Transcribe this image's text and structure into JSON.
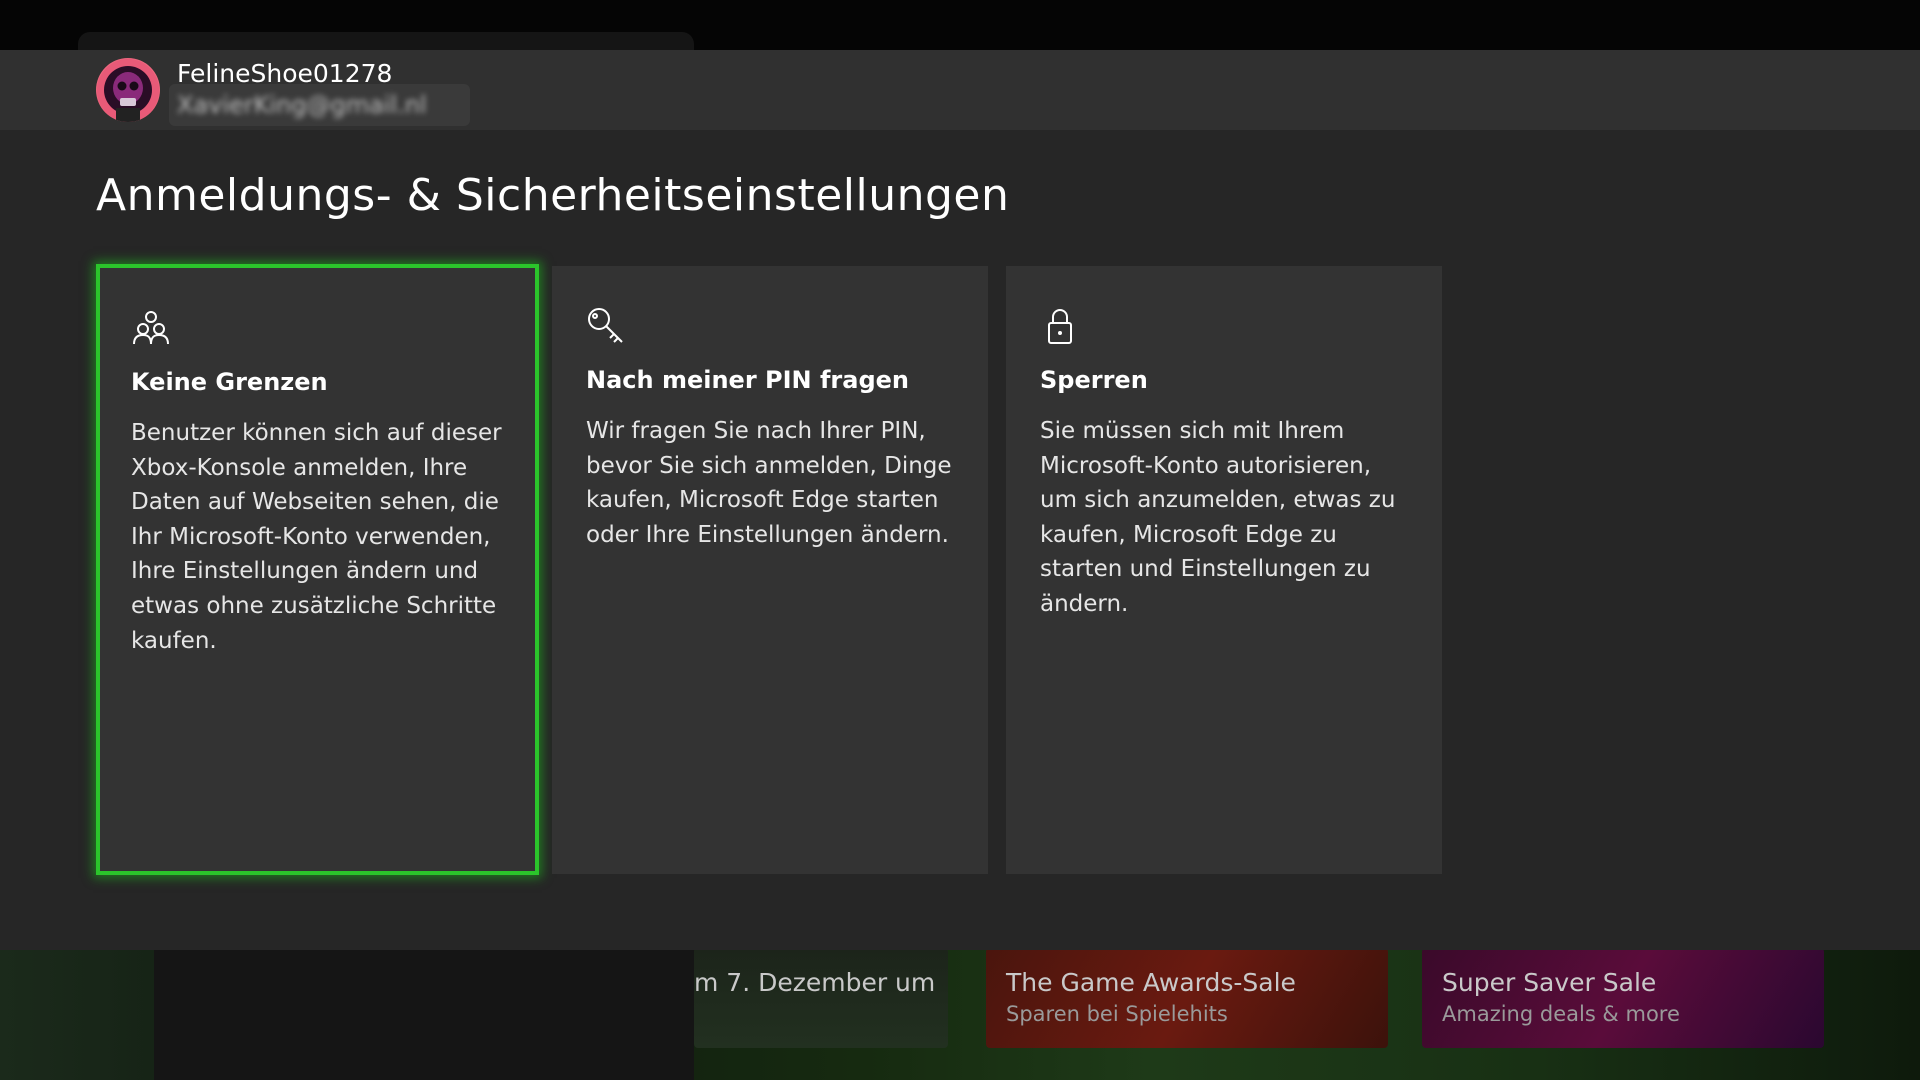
{
  "profile": {
    "gamertag": "FelineShoe01278",
    "email": "XavierKing@gmail.nl"
  },
  "page_title": "Anmeldungs- & Sicherheitseinstellungen",
  "options": [
    {
      "icon": "people-icon",
      "title": "Keine Grenzen",
      "description": "Benutzer können sich auf dieser Xbox-Konsole anmelden, Ihre Daten auf Webseiten sehen, die Ihr Microsoft-Konto verwenden, Ihre Einstellungen ändern und etwas ohne zusätzliche Schritte kaufen.",
      "selected": true
    },
    {
      "icon": "key-icon",
      "title": "Nach meiner PIN fragen",
      "description": "Wir fragen Sie nach Ihrer PIN, bevor Sie sich anmelden, Dinge kaufen, Microsoft Edge starten oder Ihre Einstellungen ändern.",
      "selected": false
    },
    {
      "icon": "lock-icon",
      "title": "Sperren",
      "description": "Sie müssen sich mit Ihrem Microsoft-Konto autorisieren, um sich anzumelden, etwas zu kaufen, Microsoft Edge zu starten und Einstellungen zu ändern.",
      "selected": false
    }
  ],
  "background_tiles": [
    {
      "title": "m 7. Dezember um",
      "subtitle": ""
    },
    {
      "title": "The Game Awards-Sale",
      "subtitle": "Sparen bei Spielehits"
    },
    {
      "title": "Super Saver Sale",
      "subtitle": "Amazing deals & more"
    }
  ],
  "colors": {
    "focus": "#2bc52b",
    "dialog_bg": "#262626",
    "card_bg": "#333333"
  }
}
